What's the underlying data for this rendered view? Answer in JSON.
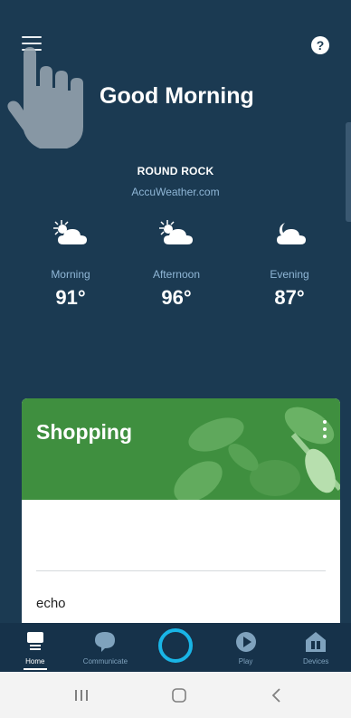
{
  "header": {
    "greeting": "Good Morning",
    "menu_icon": "hamburger-menu-icon",
    "help_icon": "help-icon",
    "help_glyph": "?"
  },
  "weather": {
    "location": "ROUND ROCK",
    "source": "AccuWeather.com",
    "forecast": [
      {
        "period": "Morning",
        "temp": "91°",
        "icon": "sun-cloud-icon"
      },
      {
        "period": "Afternoon",
        "temp": "96°",
        "icon": "sun-cloud-icon"
      },
      {
        "period": "Evening",
        "temp": "87°",
        "icon": "moon-cloud-icon"
      }
    ]
  },
  "shopping_card": {
    "title": "Shopping",
    "items": [
      "echo"
    ],
    "banner_color": "#3f8f3f"
  },
  "bottom_nav": {
    "items": [
      {
        "label": "Home",
        "icon": "home-icon",
        "active": true
      },
      {
        "label": "Communicate",
        "icon": "chat-bubble-icon",
        "active": false
      },
      {
        "label": "",
        "icon": "alexa-ring-icon",
        "active": false
      },
      {
        "label": "Play",
        "icon": "play-icon",
        "active": false
      },
      {
        "label": "Devices",
        "icon": "devices-house-icon",
        "active": false
      }
    ]
  },
  "colors": {
    "background": "#1b3a52",
    "nav_background": "#16324a",
    "alexa_blue": "#19b5e6",
    "subtle_text": "#8fb6d6"
  }
}
